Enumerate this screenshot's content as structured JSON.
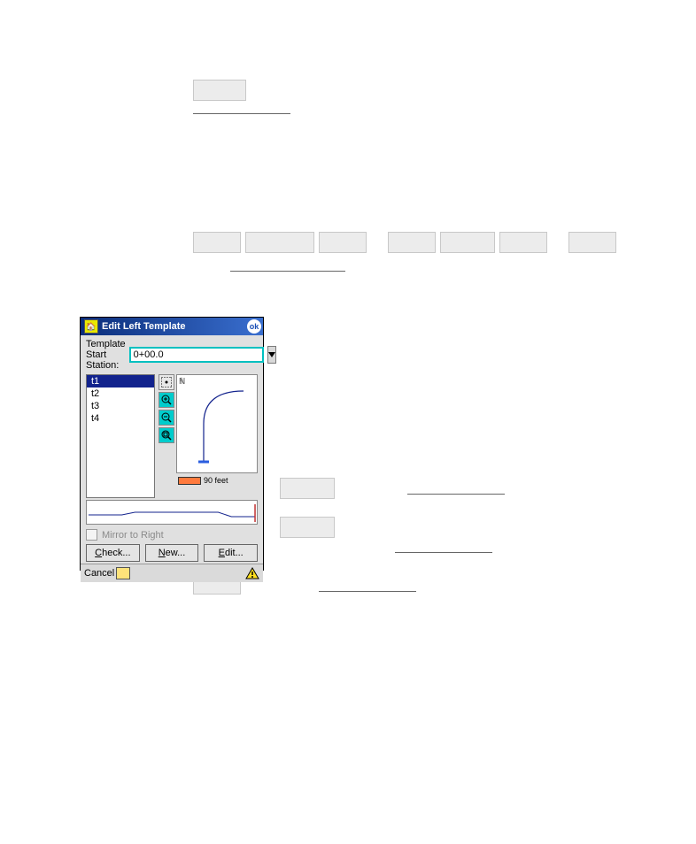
{
  "dialog": {
    "title": "Edit Left Template",
    "ok": "ok",
    "station_label_line1": "Template Start",
    "station_label_line2": "Station:",
    "station_value": "0+00.0",
    "list": [
      "t1",
      "t2",
      "t3",
      "t4"
    ],
    "selected_index": 0,
    "north_marker": "N",
    "scale_text": "90 feet",
    "mirror_label": "Mirror to Right",
    "buttons": {
      "check": {
        "hotkey": "C",
        "rest": "heck..."
      },
      "new": {
        "hotkey": "N",
        "rest": "ew..."
      },
      "edit": {
        "hotkey": "E",
        "rest": "dit..."
      }
    },
    "cancel": "Cancel"
  }
}
